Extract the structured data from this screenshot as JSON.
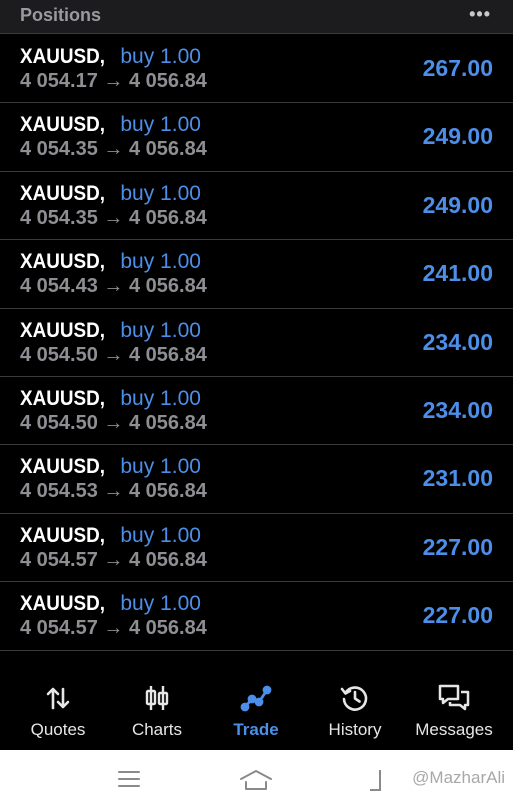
{
  "header": {
    "title": "Positions",
    "more_icon": "more-dots-icon"
  },
  "positions": [
    {
      "symbol": "XAUUSD,",
      "trade": "buy 1.00",
      "prices": "4 054.17 → 4 056.84",
      "profit": "267.00"
    },
    {
      "symbol": "XAUUSD,",
      "trade": "buy 1.00",
      "prices": "4 054.35 → 4 056.84",
      "profit": "249.00"
    },
    {
      "symbol": "XAUUSD,",
      "trade": "buy 1.00",
      "prices": "4 054.35 → 4 056.84",
      "profit": "249.00"
    },
    {
      "symbol": "XAUUSD,",
      "trade": "buy 1.00",
      "prices": "4 054.43 → 4 056.84",
      "profit": "241.00"
    },
    {
      "symbol": "XAUUSD,",
      "trade": "buy 1.00",
      "prices": "4 054.50 → 4 056.84",
      "profit": "234.00"
    },
    {
      "symbol": "XAUUSD,",
      "trade": "buy 1.00",
      "prices": "4 054.50 → 4 056.84",
      "profit": "234.00"
    },
    {
      "symbol": "XAUUSD,",
      "trade": "buy 1.00",
      "prices": "4 054.53 → 4 056.84",
      "profit": "231.00"
    },
    {
      "symbol": "XAUUSD,",
      "trade": "buy 1.00",
      "prices": "4 054.57 → 4 056.84",
      "profit": "227.00"
    },
    {
      "symbol": "XAUUSD,",
      "trade": "buy 1.00",
      "prices": "4 054.57 → 4 056.84",
      "profit": "227.00"
    }
  ],
  "tabs": [
    {
      "label": "Quotes",
      "icon": "quotes-arrows-icon"
    },
    {
      "label": "Charts",
      "icon": "candlestick-icon"
    },
    {
      "label": "Trade",
      "icon": "trade-line-icon",
      "active": true
    },
    {
      "label": "History",
      "icon": "history-clock-icon"
    },
    {
      "label": "Messages",
      "icon": "messages-icon"
    }
  ],
  "watermark": "@MazharAli",
  "colors": {
    "accent": "#4d8ee8",
    "background": "#000000",
    "secondary_text": "#8e8e93"
  }
}
